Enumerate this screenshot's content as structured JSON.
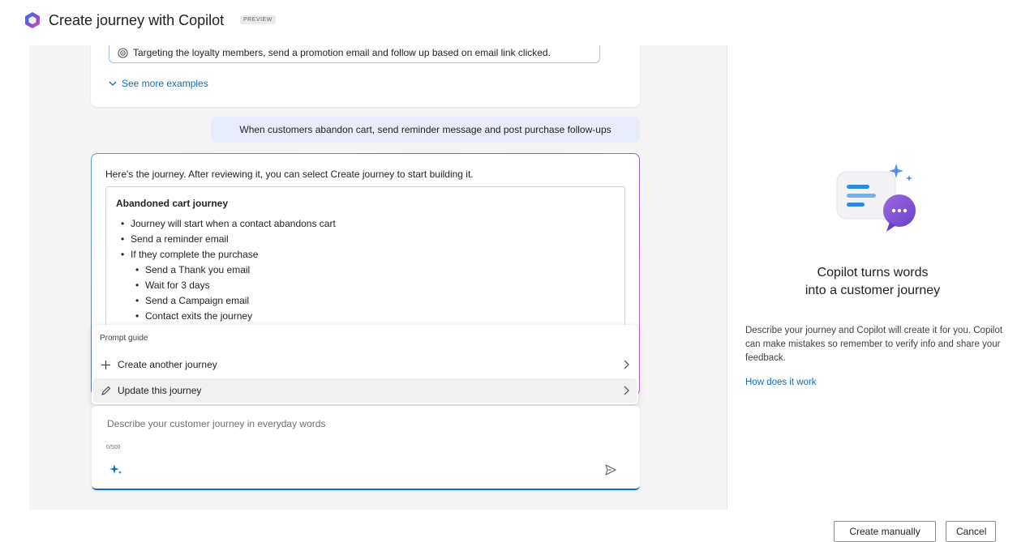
{
  "header": {
    "title": "Create journey with Copilot",
    "badge": "PREVIEW"
  },
  "examples": {
    "chip_text": "Targeting the loyalty members, send a promotion email and follow up based on email link clicked.",
    "see_more": "See more examples"
  },
  "user_message": "When customers abandon cart, send reminder message and post purchase follow-ups",
  "response": {
    "intro": "Here's the journey. After reviewing it, you can select Create journey to start building it.",
    "journey_title": "Abandoned cart journey",
    "steps": [
      "Journey will start when a contact abandons cart",
      "Send a reminder email",
      "If they complete the purchase",
      "Send a Thank you email",
      "Wait for 3 days",
      "Send a Campaign email",
      "Contact exits the journey"
    ]
  },
  "prompt_guide": {
    "title": "Prompt guide",
    "items": [
      {
        "label": "Create another journey",
        "icon": "plus-icon"
      },
      {
        "label": "Update this journey",
        "icon": "pencil-icon"
      }
    ]
  },
  "composer": {
    "placeholder": "Describe your customer journey in everyday words",
    "counter": "0/500"
  },
  "info_panel": {
    "heading_line1": "Copilot turns words",
    "heading_line2": "into a customer journey",
    "description": "Describe your journey and Copilot will create it for you. Copilot can make mistakes so remember to verify info and share your feedback.",
    "link": "How does it work"
  },
  "footer": {
    "create_manually": "Create manually",
    "cancel": "Cancel"
  },
  "colors": {
    "accent": "#0f6cbd",
    "user_bubble": "#e8ebfa",
    "panel_bg": "#f5f5f5"
  }
}
